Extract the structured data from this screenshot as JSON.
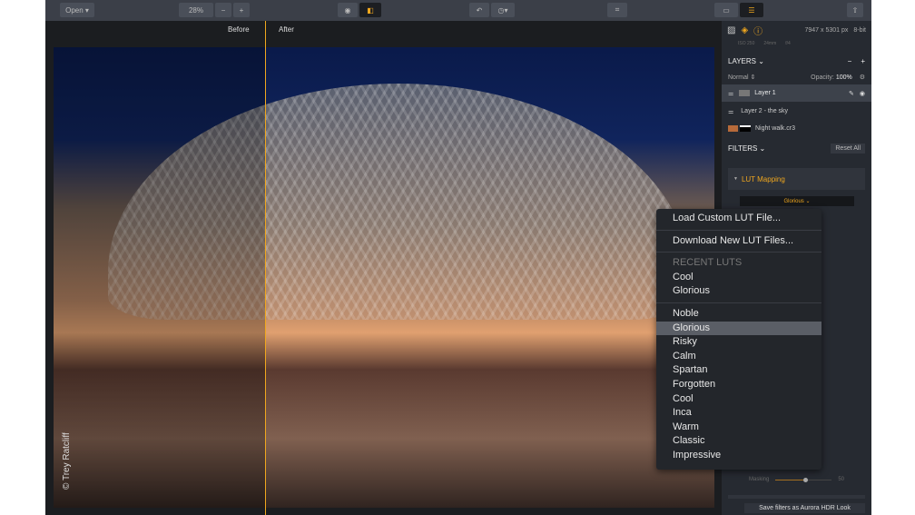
{
  "toolbar": {
    "open": "Open ▾",
    "zoom": "28%",
    "zoom_minus": "−",
    "zoom_plus": "+"
  },
  "canvas": {
    "before_label": "Before",
    "after_label": "After",
    "watermark": "© Trey Ratcliff"
  },
  "panel": {
    "dimensions": "7947 x 5301 px",
    "bit_depth": "8-bit",
    "exif": [
      "ISO 250",
      "24mm",
      "f/4"
    ],
    "layers_title": "LAYERS ⌄",
    "blend_mode": "Normal ⇕",
    "opacity_label": "Opacity:",
    "opacity_value": "100%",
    "layers": [
      {
        "name": "Layer 1",
        "selected": true
      },
      {
        "name": "Layer 2 - the sky"
      },
      {
        "name": "Night walk.cr3"
      }
    ],
    "filters_title": "FILTERS ⌄",
    "reset_all": "Reset All",
    "filter_name": "LUT Mapping",
    "lut_value": "Glorious ⌄",
    "masking_label": "Masking",
    "masking_value": "50",
    "save_look": "Save filters as Aurora HDR Look"
  },
  "accent": "#f0a71e",
  "menu": {
    "actions": [
      "Load Custom LUT File...",
      "Download New LUT Files..."
    ],
    "recent_header": "RECENT LUTS",
    "recent": [
      "Cool",
      "Glorious"
    ],
    "luts": [
      "Noble",
      "Glorious",
      "Risky",
      "Calm",
      "Spartan",
      "Forgotten",
      "Cool",
      "Inca",
      "Warm",
      "Classic",
      "Impressive"
    ],
    "selected": "Glorious"
  }
}
